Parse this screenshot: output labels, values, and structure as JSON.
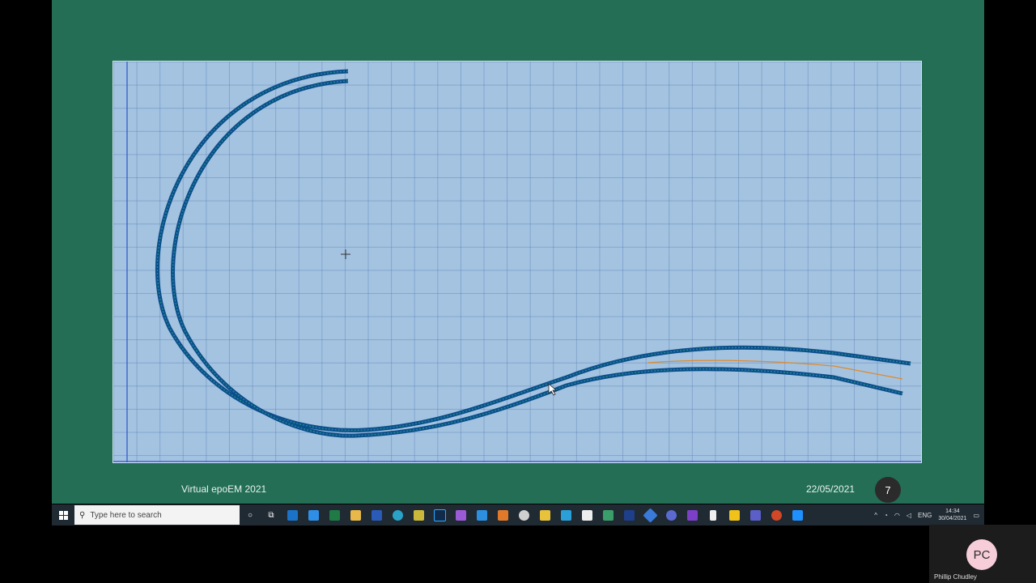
{
  "slide": {
    "footer_left": "Virtual epoEM 2021",
    "footer_date": "22/05/2021",
    "slide_number": "7"
  },
  "taskbar": {
    "search_placeholder": "Type here to search",
    "icons": [
      "cortana-icon",
      "task-view-icon",
      "outlook-icon",
      "mail-icon",
      "excel-icon",
      "file-explorer-icon",
      "word-icon",
      "edge-icon",
      "app-icon",
      "photoshop-icon",
      "app-icon",
      "app-icon",
      "app-icon",
      "app-icon",
      "app-icon",
      "app-icon",
      "app-icon",
      "app-icon",
      "app-icon",
      "app-icon",
      "app-icon",
      "visual-studio-icon",
      "app-icon",
      "app-icon",
      "teams-icon",
      "powerpoint-icon",
      "app-icon"
    ],
    "language": "ENG",
    "time": "14:34",
    "date": "30/04/2021"
  },
  "participant": {
    "initials": "PC",
    "name": "Phillip Chudley"
  },
  "colors": {
    "slide_bg": "#236e55",
    "canvas_bg": "#a4c3e1",
    "track": "#0b4d8c",
    "highlight": "#e08a2a"
  }
}
